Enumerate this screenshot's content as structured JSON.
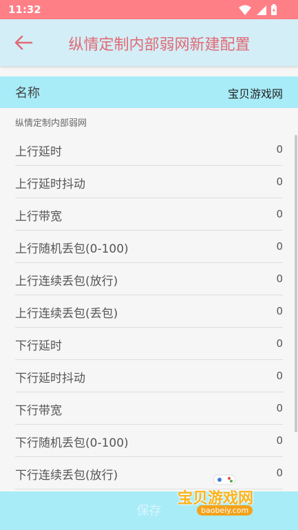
{
  "status": {
    "time": "11:32"
  },
  "header": {
    "title": "纵情定制内部弱网新建配置"
  },
  "name_row": {
    "label": "名称",
    "value": "宝贝游戏网"
  },
  "section": {
    "title": "纵情定制内部弱网"
  },
  "fields": [
    {
      "label": "上行延时",
      "value": "0"
    },
    {
      "label": "上行延时抖动",
      "value": "0"
    },
    {
      "label": "上行带宽",
      "value": "0"
    },
    {
      "label": "上行随机丢包(0-100)",
      "value": "0"
    },
    {
      "label": "上行连续丢包(放行)",
      "value": "0"
    },
    {
      "label": "上行连续丢包(丢包)",
      "value": "0"
    },
    {
      "label": "下行延时",
      "value": "0"
    },
    {
      "label": "下行延时抖动",
      "value": "0"
    },
    {
      "label": "下行带宽",
      "value": "0"
    },
    {
      "label": "下行随机丢包(0-100)",
      "value": "0"
    },
    {
      "label": "下行连续丢包(放行)",
      "value": "0"
    }
  ],
  "footer": {
    "save_label": "保存"
  },
  "watermark": {
    "text": "宝贝游戏网",
    "url": "baobeiy.com"
  }
}
